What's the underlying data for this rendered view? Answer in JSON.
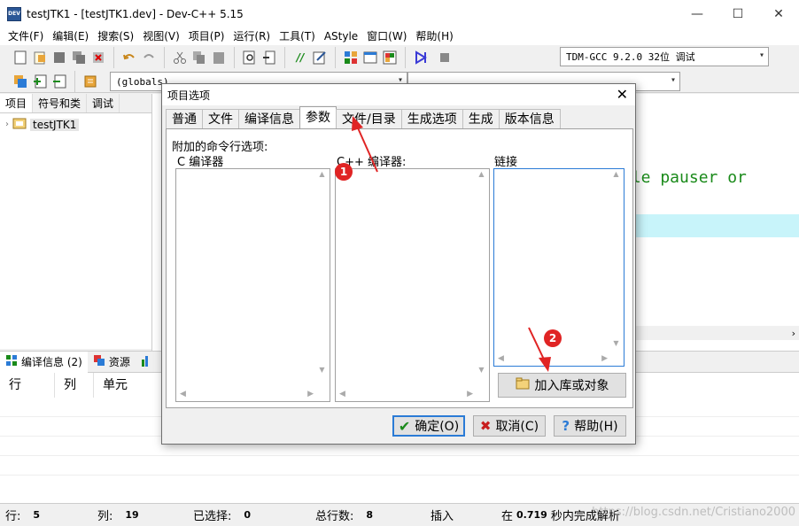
{
  "window": {
    "title": "testJTK1 - [testJTK1.dev] - Dev-C++ 5.15",
    "icon_label": "DEV",
    "controls": {
      "minimize": "—",
      "maximize": "☐",
      "close": "✕"
    }
  },
  "menu": [
    "文件(F)",
    "编辑(E)",
    "搜索(S)",
    "视图(V)",
    "项目(P)",
    "运行(R)",
    "工具(T)",
    "AStyle",
    "窗口(W)",
    "帮助(H)"
  ],
  "toolbar": {
    "compiler_select": "TDM-GCC 9.2.0 32位 调试",
    "scope_select": "(globals)"
  },
  "left_panel": {
    "tabs": [
      "项目",
      "符号和类",
      "调试"
    ],
    "tree_node": "testJTK1"
  },
  "editor": {
    "code_fragment": "ole pauser or"
  },
  "bottom_panel": {
    "tabs": [
      "编译信息 (2)",
      "资源"
    ],
    "columns": [
      "行",
      "列",
      "单元"
    ]
  },
  "statusbar": {
    "row_label": "行:",
    "row_value": "5",
    "col_label": "列:",
    "col_value": "19",
    "sel_label": "已选择:",
    "sel_value": "0",
    "total_label": "总行数:",
    "total_value": "8",
    "insert_mode": "插入",
    "parse_prefix": "在",
    "parse_time": "0.719",
    "parse_suffix": "秒内完成解析",
    "watermark": "https://blog.csdn.net/Cristiano2000"
  },
  "dialog": {
    "title": "项目选项",
    "close": "✕",
    "tabs": [
      "普通",
      "文件",
      "编译信息",
      "参数",
      "文件/目录",
      "生成选项",
      "生成",
      "版本信息"
    ],
    "active_tab": "参数",
    "heading": "附加的命令行选项:",
    "c_label": "C 编译器",
    "cpp_label": "C++ 编译器:",
    "link_label": "链接",
    "add_button": "加入库或对象",
    "ok_button": "确定(O)",
    "cancel_button": "取消(C)",
    "help_button": "帮助(H)"
  },
  "annotations": {
    "badge1": "1",
    "badge2": "2",
    "color": "#e02424"
  }
}
